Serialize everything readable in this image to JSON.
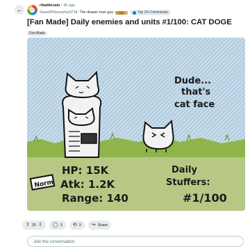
{
  "header": {
    "back_icon": "arrow-left-icon",
    "subreddit": "r/battlecats",
    "separator": "•",
    "age": "4h ago",
    "author": "SweetPhilosopher8718",
    "author_flair": "The drawer man guy",
    "badge": "Top 1% Commenter"
  },
  "post": {
    "title": "[Fan Made] Daily enemies and units #1/100: CAT DOGE",
    "flair": "Fan-Made",
    "drawing": {
      "caption_lines": [
        "Dude...",
        "that's",
        "cat face"
      ],
      "stats_lines": [
        "HP: 15K",
        "Atk: 1.2K",
        "Range: 140"
      ],
      "footer_lines": [
        "Daily",
        "Stuffers:",
        "#1/100"
      ],
      "tag": "Norm"
    }
  },
  "actions": {
    "votes": "25",
    "comments": "3",
    "crossposts": "3",
    "share_label": "Share"
  },
  "comment": {
    "placeholder": "Join the conversation"
  },
  "colors": {
    "accent": "#0079d3",
    "pill_bg": "#e5ebee",
    "sky": "#cfe1ec",
    "grass": "#8fb54a"
  }
}
